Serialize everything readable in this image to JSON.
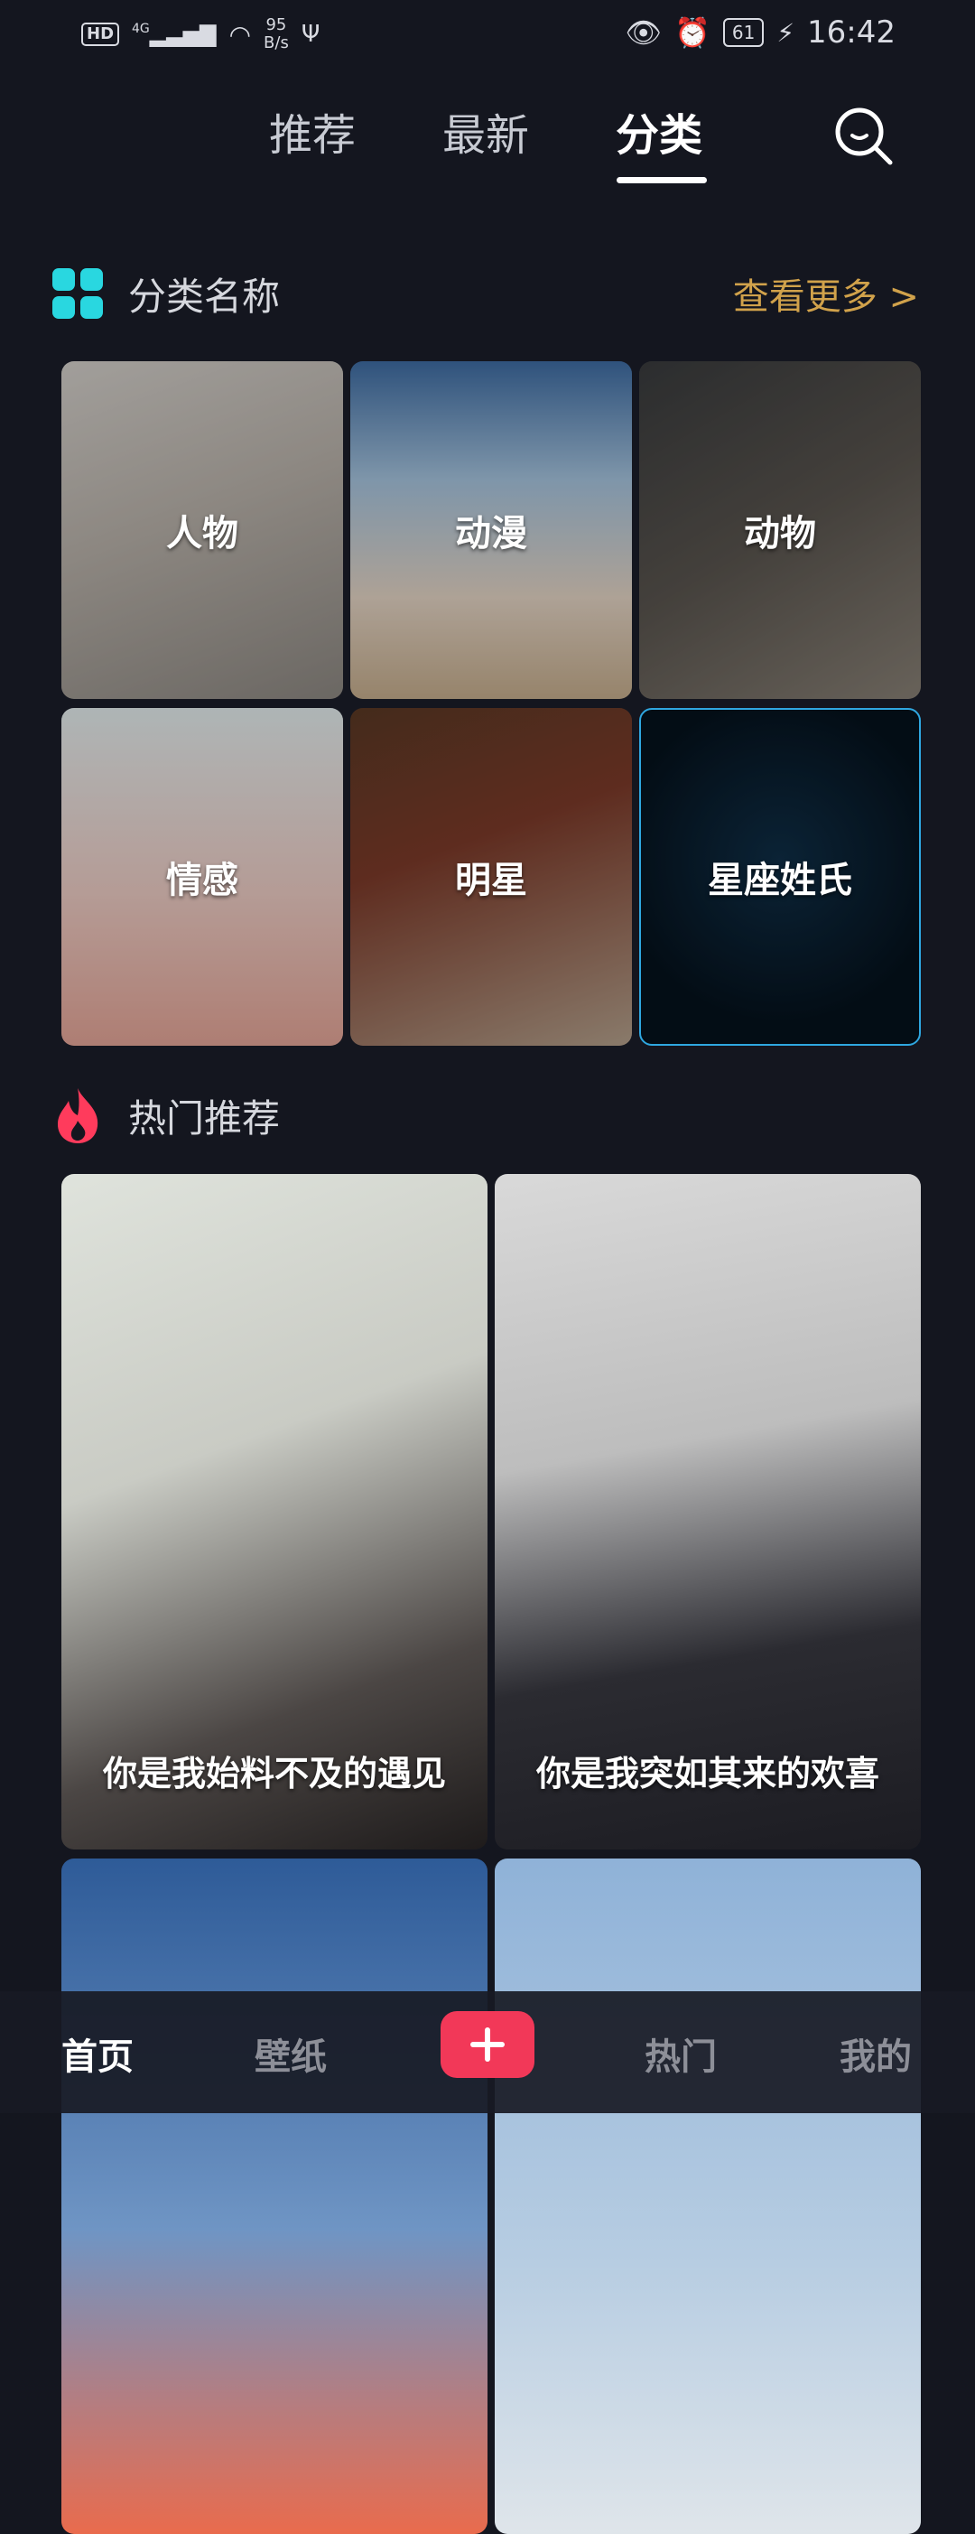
{
  "status_bar": {
    "hd": "HD",
    "network": "4G",
    "speed_value": "95",
    "speed_unit": "B/s",
    "battery": "61",
    "time": "16:42"
  },
  "tabs": [
    {
      "label": "推荐"
    },
    {
      "label": "最新"
    },
    {
      "label": "分类"
    }
  ],
  "active_tab": "分类",
  "category_section": {
    "title": "分类名称",
    "more": "查看更多 >"
  },
  "categories": [
    {
      "label": "人物"
    },
    {
      "label": "动漫"
    },
    {
      "label": "动物"
    },
    {
      "label": "情感"
    },
    {
      "label": "明星"
    },
    {
      "label": "星座姓氏"
    }
  ],
  "hot_section": {
    "title": "热门推荐"
  },
  "hot_items": [
    {
      "caption": "你是我始料不及的遇见"
    },
    {
      "caption": "你是我突如其来的欢喜"
    },
    {
      "caption": ""
    },
    {
      "caption": ""
    }
  ],
  "bottom_nav": {
    "home": "首页",
    "wallpaper": "壁纸",
    "hot": "热门",
    "mine": "我的"
  },
  "colors": {
    "background": "#14161f",
    "accent_more": "#d1a24b",
    "category_icon": "#29d7e0",
    "fire_icon": "#ff3b5c",
    "plus_button": "#f23858"
  }
}
